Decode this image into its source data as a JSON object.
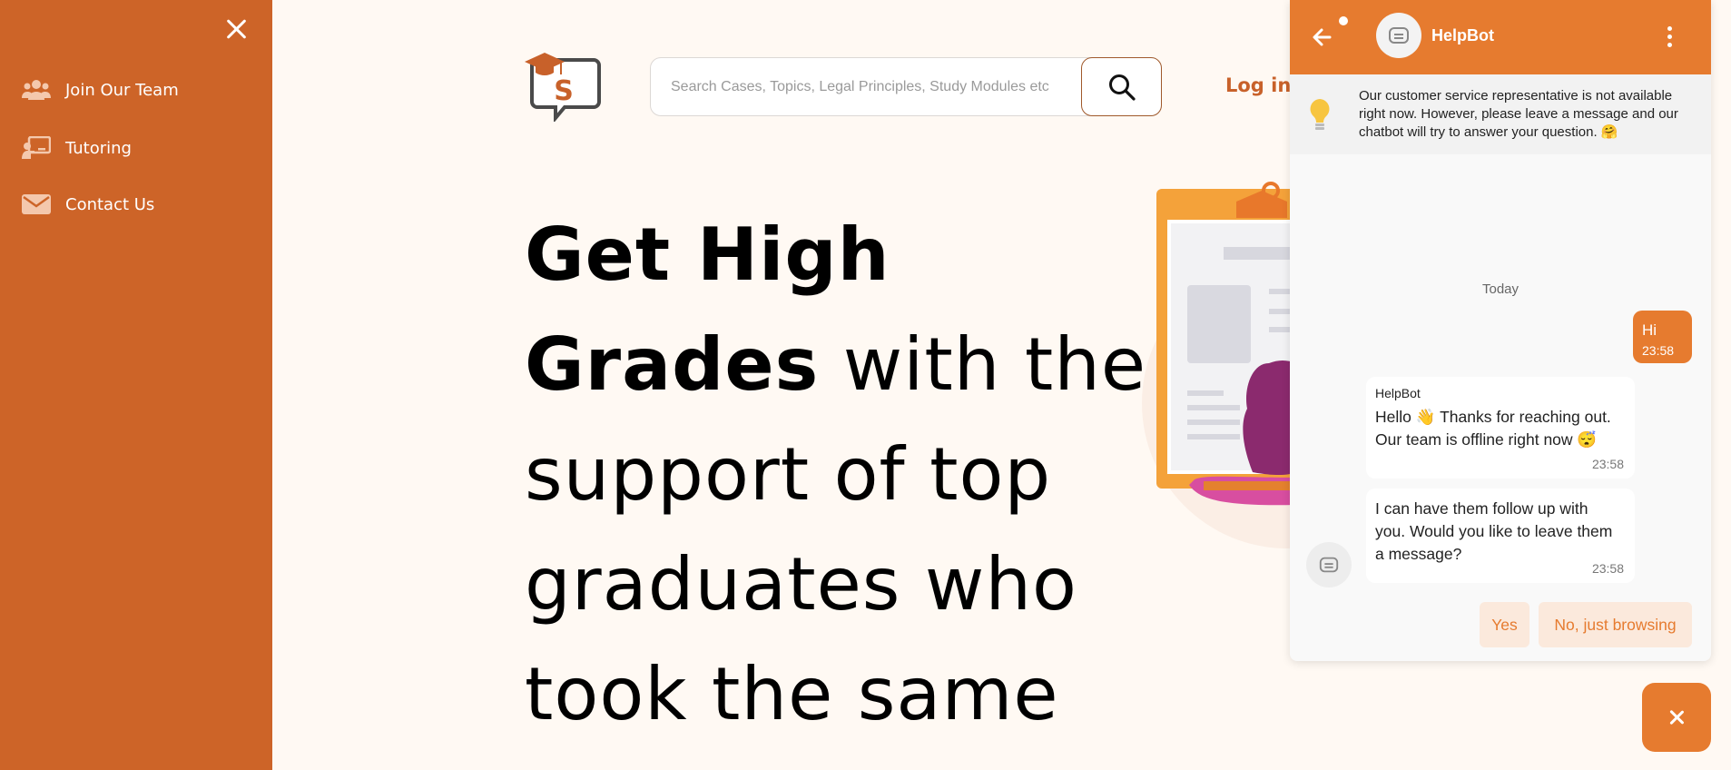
{
  "sidebar": {
    "items": [
      {
        "label": "Join Our Team",
        "icon": "users-icon"
      },
      {
        "label": "Tutoring",
        "icon": "chalkboard-teacher-icon"
      },
      {
        "label": "Contact Us",
        "icon": "envelope-icon"
      }
    ]
  },
  "header": {
    "logo_letter": "S",
    "search_placeholder": "Search Cases, Topics, Legal Principles, Study Modules etc",
    "login_label": "Log in"
  },
  "hero": {
    "bold_text": "Get High Grades",
    "rest_text": "with the support of top graduates who took the same"
  },
  "chat": {
    "bot_name": "HelpBot",
    "notice": "Our customer service representative is not available right now. However, please leave a message and our chatbot will try to answer your question. 🤗",
    "day_label": "Today",
    "user_message": {
      "text": "Hi",
      "time": "23:58"
    },
    "bot_messages": [
      {
        "sender": "HelpBot",
        "text": "Hello 👋 Thanks for reaching out. Our team is offline right now 😴",
        "time": "23:58"
      },
      {
        "text": "I can have them follow up with you. Would you like to leave them a message?",
        "time": "23:58"
      }
    ],
    "quick_replies": [
      "Yes",
      "No, just browsing"
    ]
  },
  "colors": {
    "sidebar": "#cd6428",
    "accent": "#e67b2f",
    "page_bg": "#fff9f3"
  }
}
